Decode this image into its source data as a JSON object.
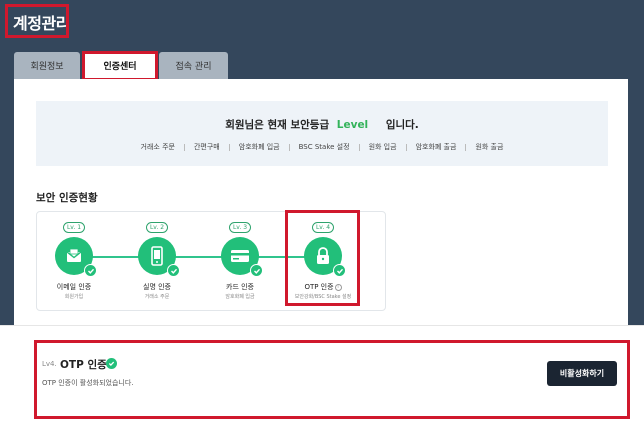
{
  "page": {
    "title": "계정관리"
  },
  "tabs": [
    {
      "label": "회원정보",
      "active": false
    },
    {
      "label": "인증센터",
      "active": true
    },
    {
      "label": "접속 관리",
      "active": false
    }
  ],
  "security_info": {
    "title_prefix": "회원님은 현재 보안등급",
    "level_text": "Level",
    "title_suffix": "입니다.",
    "links": [
      "거래소 주문",
      "간편구매",
      "암호화폐 입금",
      "BSC Stake 설정",
      "원화 입금",
      "암호화폐 출금",
      "원화 출금"
    ]
  },
  "section": {
    "title": "보안 인증현황"
  },
  "steps": [
    {
      "badge": "Lv. 1",
      "label": "이메일 인증",
      "sub": "회원가입",
      "icon": "envelope-icon",
      "completed": true
    },
    {
      "badge": "Lv. 2",
      "label": "실명 인증",
      "sub": "거래소 주문",
      "icon": "mobile-phone-icon",
      "completed": true
    },
    {
      "badge": "Lv. 3",
      "label": "카드 인증",
      "sub": "암호화폐 입금",
      "icon": "credit-card-icon",
      "completed": true
    },
    {
      "badge": "Lv. 4",
      "label": "OTP 인증",
      "sub": "보안강화/BSC Stake 설정",
      "icon": "lock-icon",
      "completed": true,
      "info_glyph": "i"
    }
  ],
  "otp_panel": {
    "level_prefix": "Lv4.",
    "title": "OTP 인증",
    "description": "OTP 인증이 활성화되었습니다.",
    "button_label": "비활성화하기"
  },
  "colors": {
    "header_bg": "#34475c",
    "accent_green": "#22bf7a",
    "level_text_green": "#32b35a",
    "highlight_red": "#d0182d",
    "button_dark": "#1b2532",
    "inactive_tab": "#a9b4bf"
  }
}
